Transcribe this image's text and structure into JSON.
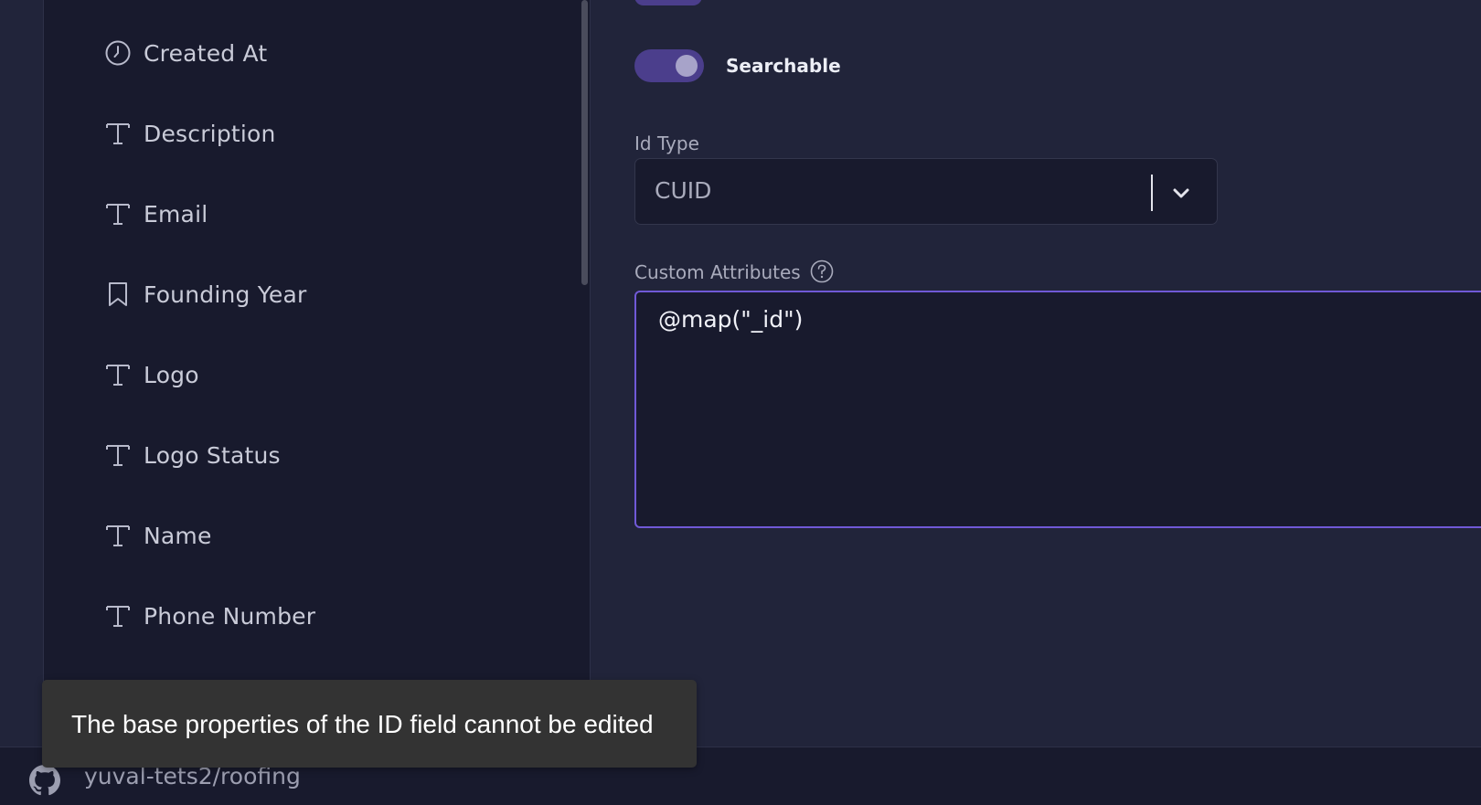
{
  "field_list": {
    "items": [
      {
        "label": "Created At",
        "icon": "clock-icon"
      },
      {
        "label": "Description",
        "icon": "text-icon"
      },
      {
        "label": "Email",
        "icon": "text-icon"
      },
      {
        "label": "Founding Year",
        "icon": "bookmark-icon"
      },
      {
        "label": "Logo",
        "icon": "text-icon"
      },
      {
        "label": "Logo Status",
        "icon": "text-icon"
      },
      {
        "label": "Name",
        "icon": "text-icon"
      },
      {
        "label": "Phone Number",
        "icon": "text-icon"
      }
    ]
  },
  "properties": {
    "searchable_label": "Searchable",
    "searchable_on": true,
    "id_type_label": "Id Type",
    "id_type_value": "CUID",
    "custom_attributes_label": "Custom Attributes",
    "custom_attributes_value": "@map(\"_id\")"
  },
  "tooltip": {
    "text": "The base properties of the ID field cannot be edited"
  },
  "footer": {
    "repo": "yuval-tets2/roofing",
    "icon": "github-icon"
  },
  "colors": {
    "accent": "#7059d6",
    "toggle_track": "#4b3e8c",
    "panel_bg": "#181a2d",
    "page_bg": "#21243a"
  }
}
